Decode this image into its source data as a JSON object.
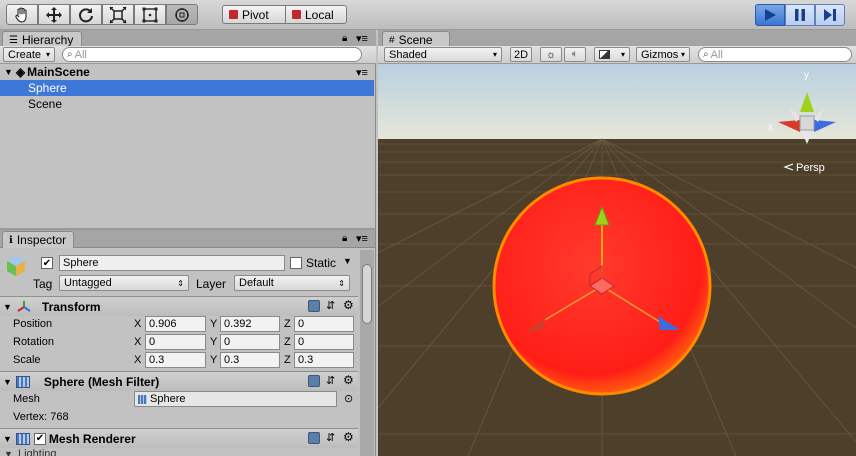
{
  "toolbar": {
    "tools": [
      "hand-tool-icon",
      "move-tool-icon",
      "rotate-tool-icon",
      "scale-tool-icon",
      "rect-tool-icon",
      "transform-tool-icon"
    ],
    "pivot_label": "Pivot",
    "local_label": "Local",
    "play_buttons": [
      "play-icon",
      "pause-icon",
      "step-icon"
    ]
  },
  "hierarchy": {
    "tab": "Hierarchy",
    "create_label": "Create",
    "search_placeholder": "All",
    "scene_name": "MainScene",
    "items": [
      "Sphere",
      "Scene"
    ]
  },
  "inspector": {
    "tab": "Inspector",
    "object_name": "Sphere",
    "static_label": "Static",
    "tag_label": "Tag",
    "tag_value": "Untagged",
    "layer_label": "Layer",
    "layer_value": "Default",
    "transform": {
      "title": "Transform",
      "position_label": "Position",
      "rotation_label": "Rotation",
      "scale_label": "Scale",
      "axes": [
        "X",
        "Y",
        "Z"
      ],
      "position": [
        "0.906",
        "0.392",
        "0"
      ],
      "rotation": [
        "0",
        "0",
        "0"
      ],
      "scale": [
        "0.3",
        "0.3",
        "0.3"
      ]
    },
    "mesh_filter": {
      "title": "Sphere (Mesh Filter)",
      "mesh_label": "Mesh",
      "mesh_value": "Sphere",
      "vertex_text": "Vertex: 768"
    },
    "mesh_renderer": {
      "title": "Mesh Renderer",
      "lighting_label": "Lighting"
    }
  },
  "scene": {
    "tab": "Scene",
    "shading": "Shaded",
    "mode_2d": "2D",
    "gizmos_label": "Gizmos",
    "search_placeholder": "All",
    "persp_label": "Persp",
    "gizmo_axes": {
      "x": "x",
      "y": "y"
    },
    "colors": {
      "sky": "#d9e4ee",
      "ground": "#4e3f2a",
      "sphere": "#ff2a1c",
      "sphere_rim": "#ff8a00",
      "axis_x": "#d83a2a",
      "axis_y": "#9ed21a",
      "axis_z": "#3c6de0",
      "selection": "#3d78d8",
      "play_blue": "#3a75d4"
    }
  }
}
